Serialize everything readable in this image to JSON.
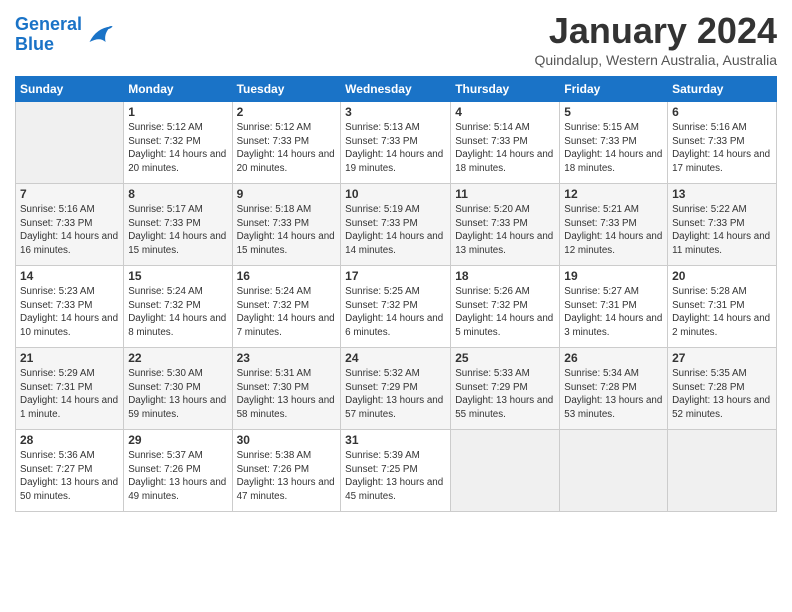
{
  "header": {
    "logo_line1": "General",
    "logo_line2": "Blue",
    "month_title": "January 2024",
    "subtitle": "Quindalup, Western Australia, Australia"
  },
  "weekdays": [
    "Sunday",
    "Monday",
    "Tuesday",
    "Wednesday",
    "Thursday",
    "Friday",
    "Saturday"
  ],
  "weeks": [
    [
      {
        "day": "",
        "sunrise": "",
        "sunset": "",
        "daylight": ""
      },
      {
        "day": "1",
        "sunrise": "5:12 AM",
        "sunset": "7:32 PM",
        "daylight": "14 hours and 20 minutes."
      },
      {
        "day": "2",
        "sunrise": "5:12 AM",
        "sunset": "7:33 PM",
        "daylight": "14 hours and 20 minutes."
      },
      {
        "day": "3",
        "sunrise": "5:13 AM",
        "sunset": "7:33 PM",
        "daylight": "14 hours and 19 minutes."
      },
      {
        "day": "4",
        "sunrise": "5:14 AM",
        "sunset": "7:33 PM",
        "daylight": "14 hours and 18 minutes."
      },
      {
        "day": "5",
        "sunrise": "5:15 AM",
        "sunset": "7:33 PM",
        "daylight": "14 hours and 18 minutes."
      },
      {
        "day": "6",
        "sunrise": "5:16 AM",
        "sunset": "7:33 PM",
        "daylight": "14 hours and 17 minutes."
      }
    ],
    [
      {
        "day": "7",
        "sunrise": "5:16 AM",
        "sunset": "7:33 PM",
        "daylight": "14 hours and 16 minutes."
      },
      {
        "day": "8",
        "sunrise": "5:17 AM",
        "sunset": "7:33 PM",
        "daylight": "14 hours and 15 minutes."
      },
      {
        "day": "9",
        "sunrise": "5:18 AM",
        "sunset": "7:33 PM",
        "daylight": "14 hours and 15 minutes."
      },
      {
        "day": "10",
        "sunrise": "5:19 AM",
        "sunset": "7:33 PM",
        "daylight": "14 hours and 14 minutes."
      },
      {
        "day": "11",
        "sunrise": "5:20 AM",
        "sunset": "7:33 PM",
        "daylight": "14 hours and 13 minutes."
      },
      {
        "day": "12",
        "sunrise": "5:21 AM",
        "sunset": "7:33 PM",
        "daylight": "14 hours and 12 minutes."
      },
      {
        "day": "13",
        "sunrise": "5:22 AM",
        "sunset": "7:33 PM",
        "daylight": "14 hours and 11 minutes."
      }
    ],
    [
      {
        "day": "14",
        "sunrise": "5:23 AM",
        "sunset": "7:33 PM",
        "daylight": "14 hours and 10 minutes."
      },
      {
        "day": "15",
        "sunrise": "5:24 AM",
        "sunset": "7:32 PM",
        "daylight": "14 hours and 8 minutes."
      },
      {
        "day": "16",
        "sunrise": "5:24 AM",
        "sunset": "7:32 PM",
        "daylight": "14 hours and 7 minutes."
      },
      {
        "day": "17",
        "sunrise": "5:25 AM",
        "sunset": "7:32 PM",
        "daylight": "14 hours and 6 minutes."
      },
      {
        "day": "18",
        "sunrise": "5:26 AM",
        "sunset": "7:32 PM",
        "daylight": "14 hours and 5 minutes."
      },
      {
        "day": "19",
        "sunrise": "5:27 AM",
        "sunset": "7:31 PM",
        "daylight": "14 hours and 3 minutes."
      },
      {
        "day": "20",
        "sunrise": "5:28 AM",
        "sunset": "7:31 PM",
        "daylight": "14 hours and 2 minutes."
      }
    ],
    [
      {
        "day": "21",
        "sunrise": "5:29 AM",
        "sunset": "7:31 PM",
        "daylight": "14 hours and 1 minute."
      },
      {
        "day": "22",
        "sunrise": "5:30 AM",
        "sunset": "7:30 PM",
        "daylight": "13 hours and 59 minutes."
      },
      {
        "day": "23",
        "sunrise": "5:31 AM",
        "sunset": "7:30 PM",
        "daylight": "13 hours and 58 minutes."
      },
      {
        "day": "24",
        "sunrise": "5:32 AM",
        "sunset": "7:29 PM",
        "daylight": "13 hours and 57 minutes."
      },
      {
        "day": "25",
        "sunrise": "5:33 AM",
        "sunset": "7:29 PM",
        "daylight": "13 hours and 55 minutes."
      },
      {
        "day": "26",
        "sunrise": "5:34 AM",
        "sunset": "7:28 PM",
        "daylight": "13 hours and 53 minutes."
      },
      {
        "day": "27",
        "sunrise": "5:35 AM",
        "sunset": "7:28 PM",
        "daylight": "13 hours and 52 minutes."
      }
    ],
    [
      {
        "day": "28",
        "sunrise": "5:36 AM",
        "sunset": "7:27 PM",
        "daylight": "13 hours and 50 minutes."
      },
      {
        "day": "29",
        "sunrise": "5:37 AM",
        "sunset": "7:26 PM",
        "daylight": "13 hours and 49 minutes."
      },
      {
        "day": "30",
        "sunrise": "5:38 AM",
        "sunset": "7:26 PM",
        "daylight": "13 hours and 47 minutes."
      },
      {
        "day": "31",
        "sunrise": "5:39 AM",
        "sunset": "7:25 PM",
        "daylight": "13 hours and 45 minutes."
      },
      {
        "day": "",
        "sunrise": "",
        "sunset": "",
        "daylight": ""
      },
      {
        "day": "",
        "sunrise": "",
        "sunset": "",
        "daylight": ""
      },
      {
        "day": "",
        "sunrise": "",
        "sunset": "",
        "daylight": ""
      }
    ]
  ]
}
